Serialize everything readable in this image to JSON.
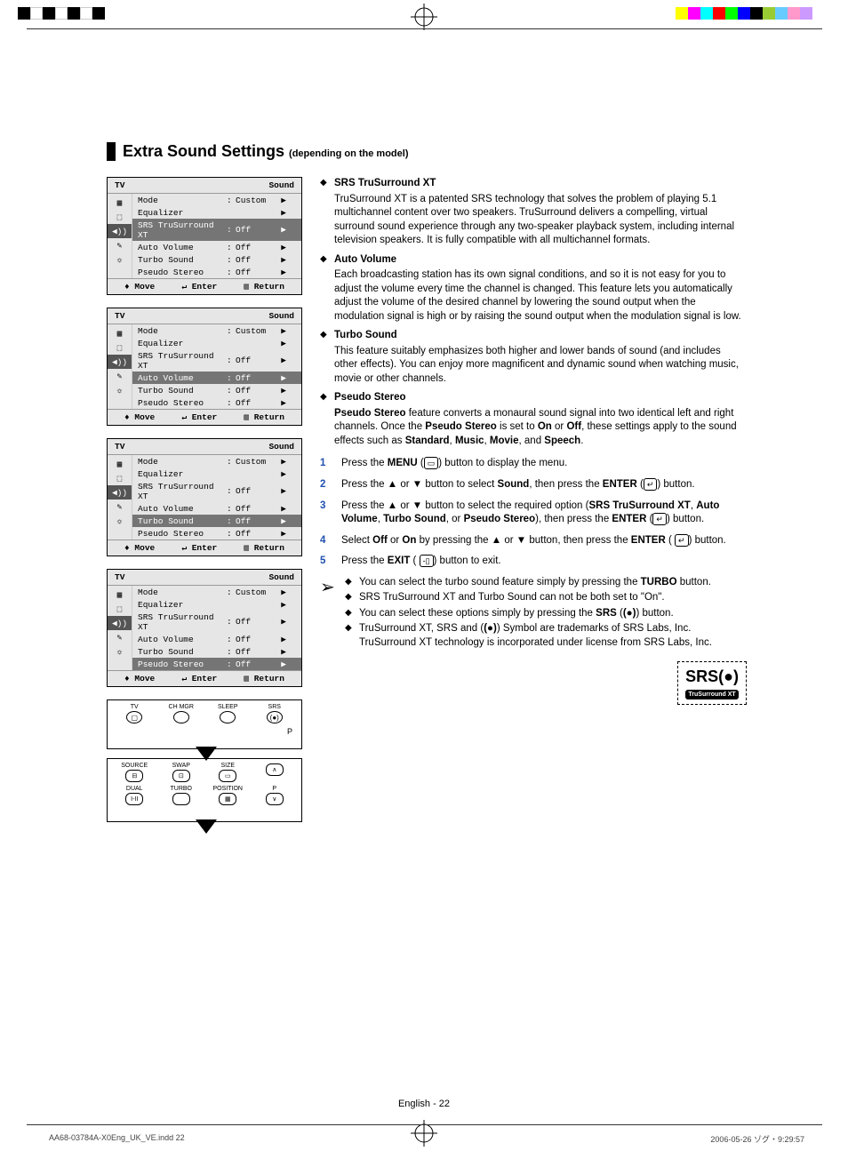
{
  "colors_left": [
    "#000",
    "#fff",
    "#000",
    "#fff",
    "#000",
    "#fff",
    "#000"
  ],
  "colors_right": [
    "#ffff00",
    "#ff00ff",
    "#00ffff",
    "#ff0000",
    "#00ff00",
    "#0000ff",
    "#000",
    "#99cc33",
    "#66ccff",
    "#ff99cc",
    "#cc99ff"
  ],
  "page": {
    "title": "Extra Sound Settings",
    "subtitle": "(depending on the model)"
  },
  "osd": {
    "header_left": "TV",
    "header_right": "Sound",
    "icons": [
      "picture",
      "input",
      "sound",
      "setup",
      "gear"
    ],
    "rows": [
      {
        "label": "Mode",
        "value": "Custom",
        "arrow": "▶"
      },
      {
        "label": "Equalizer",
        "value": "",
        "arrow": "▶"
      },
      {
        "label": "SRS TruSurround XT",
        "value": "Off",
        "arrow": "▶"
      },
      {
        "label": "Auto Volume",
        "value": "Off",
        "arrow": "▶"
      },
      {
        "label": "Turbo Sound",
        "value": "Off",
        "arrow": "▶"
      },
      {
        "label": "Pseudo Stereo",
        "value": "Off",
        "arrow": "▶"
      }
    ],
    "footer": {
      "move": "Move",
      "enter": "Enter",
      "return": "Return"
    },
    "highlights": [
      2,
      3,
      4,
      5
    ]
  },
  "remote1": {
    "labels": [
      "TV",
      "CH MGR",
      "SLEEP",
      "SRS"
    ],
    "side": "P"
  },
  "remote2": {
    "row1": [
      "SOURCE",
      "SWAP",
      "SIZE",
      ""
    ],
    "row2": [
      "DUAL",
      "TURBO",
      "POSITION",
      "P"
    ]
  },
  "sections": [
    {
      "title": "SRS TruSurround XT",
      "body": "TruSurround XT is a patented SRS technology that solves the problem of playing 5.1 multichannel content over two speakers. TruSurround delivers a compelling, virtual surround sound experience through any two-speaker playback system, including internal television speakers. It is fully compatible with all multichannel formats."
    },
    {
      "title": "Auto Volume",
      "body": "Each broadcasting station has its own signal conditions, and so it is not easy for you to adjust the volume every time the channel is changed. This feature lets you automatically adjust the volume of the desired channel by lowering the sound output when the modulation signal is high or by raising the sound output when the modulation signal is low."
    },
    {
      "title": "Turbo Sound",
      "body": "This feature suitably emphasizes both higher and lower bands of sound (and includes other effects). You can enjoy more magnificent and dynamic sound when watching music, movie or other channels."
    },
    {
      "title": "Pseudo Stereo",
      "body_html": "<b>Pseudo Stereo</b> feature converts a monaural sound signal into two identical left and right channels. Once the <b>Pseudo Stereo</b> is set to <b>On</b> or <b>Off</b>, these settings apply to the sound effects such as <b>Standard</b>, <b>Music</b>, <b>Movie</b>, and <b>Speech</b>."
    }
  ],
  "steps": [
    {
      "n": "1",
      "html": "Press the <b>MENU</b> (<span class='iconbox'>▭</span>) button to display the menu."
    },
    {
      "n": "2",
      "html": "Press the ▲ or ▼ button to select <b>Sound</b>, then press the <b>ENTER</b> (<span class='iconbox'>↵</span>) button."
    },
    {
      "n": "3",
      "html": "Press the ▲ or ▼ button to select the required option (<b>SRS TruSurround XT</b>, <b>Auto Volume</b>, <b>Turbo Sound</b>, or <b>Pseudo Stereo</b>), then press the <b>ENTER</b> (<span class='iconbox'>↵</span>) button."
    },
    {
      "n": "4",
      "html": "Select <b>Off</b> or <b>On</b> by pressing the ▲ or ▼ button, then press the <b>ENTER</b> ( <span class='iconbox'>↵</span>) button."
    },
    {
      "n": "5",
      "html": "Press the <b>EXIT</b> ( <span class='iconbox'>-▯</span>) button to exit."
    }
  ],
  "notes": [
    "You can select the turbo sound feature simply by pressing the <b>TURBO</b> button.",
    "SRS TruSurround XT and Turbo Sound can not be both set to \"On\".",
    "You can select these options simply by pressing the <b>SRS</b> (<span style='font-weight:bold'>(●)</span>) button.",
    "TruSurround XT, SRS and (<span style='font-weight:bold'>(●)</span>) Symbol are trademarks of SRS Labs, Inc. TruSurround XT technology is incorporated under license from SRS Labs, Inc."
  ],
  "srs_logo": {
    "big": "SRS(●)",
    "small": "TruSurround XT"
  },
  "page_footer": "English - 22",
  "imprint": {
    "file": "AA68-03784A-X0Eng_UK_VE.indd   22",
    "date": "2006-05-26   ゾグ・9:29:57"
  }
}
